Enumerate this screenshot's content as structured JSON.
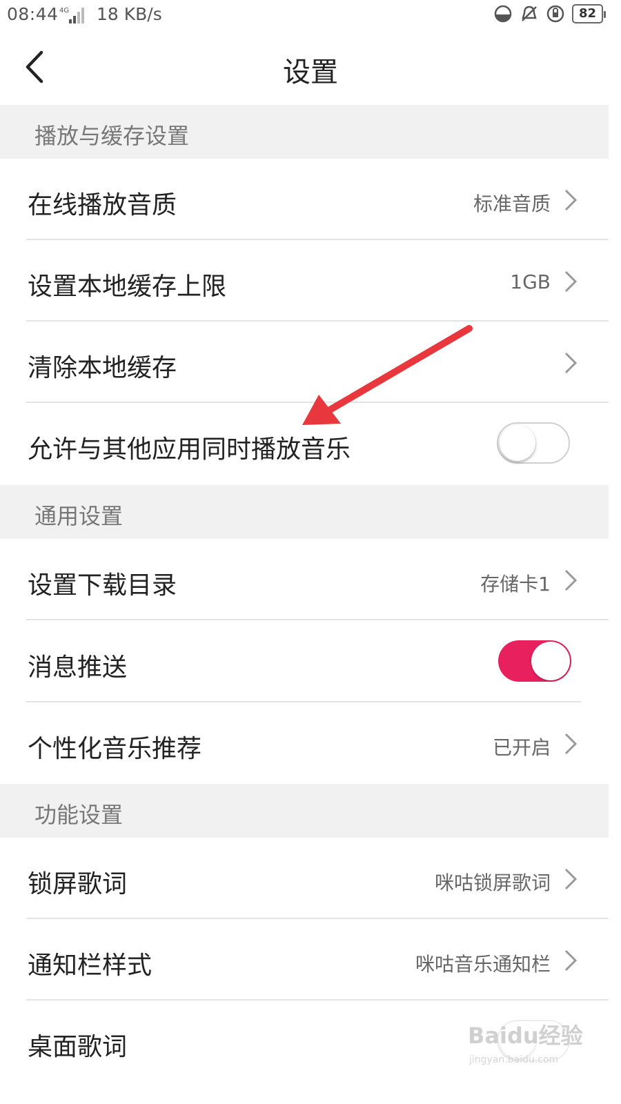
{
  "status_bar": {
    "time": "08:44",
    "network": "4G",
    "speed": "18 KB/s",
    "battery": "82",
    "icons": [
      "data-saver-icon",
      "bell-muted-icon",
      "rotation-lock-icon",
      "battery-icon"
    ]
  },
  "header": {
    "title": "设置",
    "back_icon": "chevron-left-icon"
  },
  "sections": {
    "playback": {
      "title": "播放与缓存设置",
      "items": [
        {
          "label": "在线播放音质",
          "value": "标准音质"
        },
        {
          "label": "设置本地缓存上限",
          "value": "1GB"
        },
        {
          "label": "清除本地缓存",
          "value": ""
        },
        {
          "label": "允许与其他应用同时播放音乐",
          "toggle": false
        }
      ]
    },
    "general": {
      "title": "通用设置",
      "items": [
        {
          "label": "设置下载目录",
          "value": "存储卡1"
        },
        {
          "label": "消息推送",
          "toggle": true
        },
        {
          "label": "个性化音乐推荐",
          "value": "已开启"
        }
      ]
    },
    "features": {
      "title": "功能设置",
      "items": [
        {
          "label": "锁屏歌词",
          "value": "咪咕锁屏歌词"
        },
        {
          "label": "通知栏样式",
          "value": "咪咕音乐通知栏"
        },
        {
          "label": "桌面歌词",
          "value": ""
        }
      ]
    }
  },
  "annotation": {
    "arrow_color": "#e8383d"
  },
  "colors": {
    "accent": "#e8215e",
    "section_bg": "#f1f1f1",
    "divider": "#e2e2e2"
  },
  "watermark": {
    "text": "Baidu经验",
    "url": "jingyan.baidu.com"
  }
}
